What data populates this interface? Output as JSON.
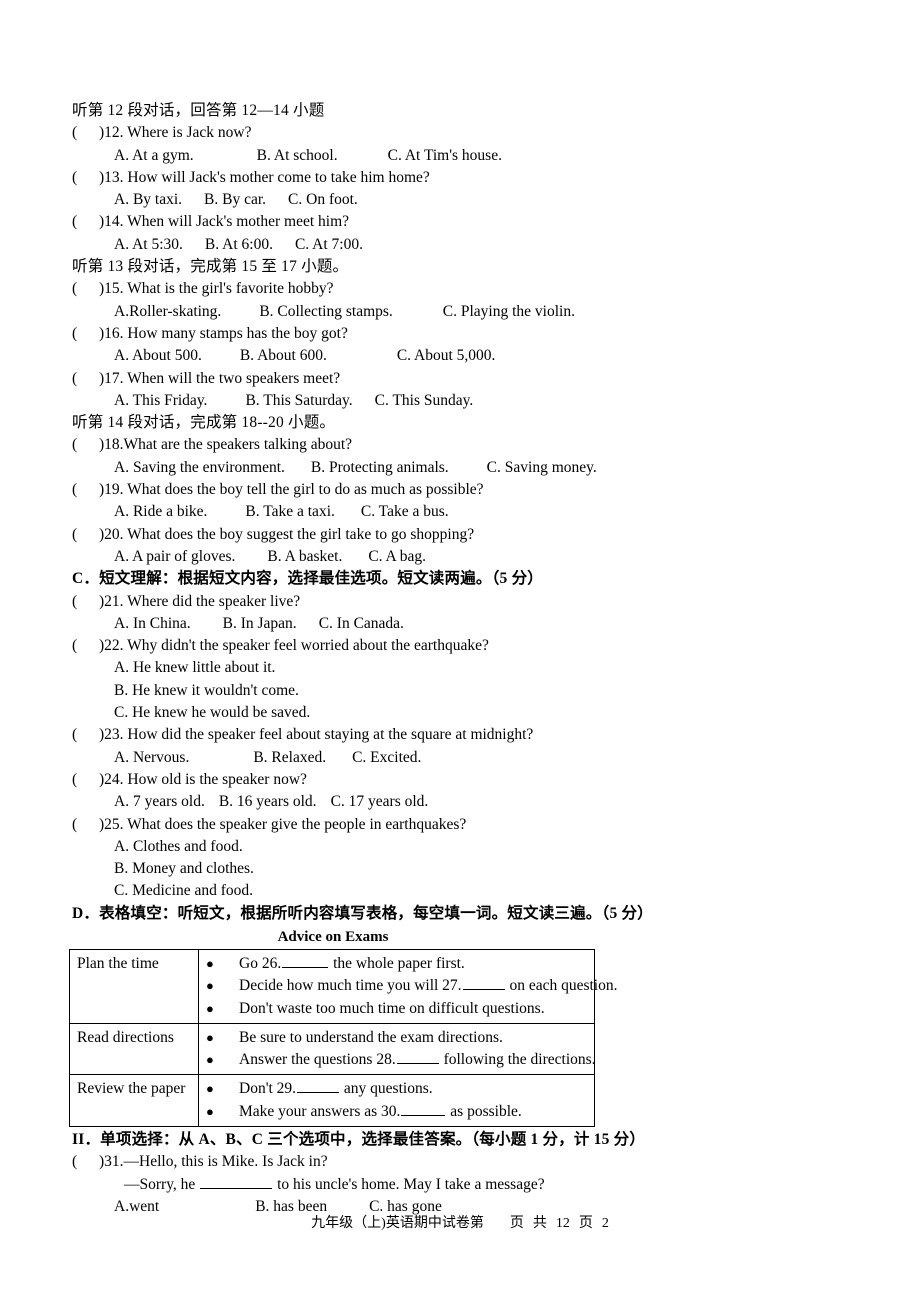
{
  "document": {
    "footer": {
      "prefix": "九年级（上)英语期中试卷第",
      "page_label": "页",
      "total_label": "共",
      "total_pages": "12",
      "pages_unit": "页",
      "page_number": "2"
    }
  },
  "sections": [
    {
      "type": "instruction",
      "name": "dialogue-12-heading",
      "text": "听第 12 段对话，回答第 12—14 小题"
    },
    {
      "type": "question",
      "number": "12",
      "stem": ")12. Where is Jack now?",
      "options": [
        {
          "label": "A. At a gym.",
          "pad": 0
        },
        {
          "label": "B. At school.",
          "pad": 63
        },
        {
          "label": "C. At Tim's house.",
          "pad": 50
        }
      ]
    },
    {
      "type": "question",
      "number": "13",
      "stem": ")13. How will Jack's mother come to take him home?",
      "options": [
        {
          "label": "A. By taxi.",
          "pad": 0
        },
        {
          "label": "B. By car.",
          "pad": 22
        },
        {
          "label": "C. On foot.",
          "pad": 22
        }
      ]
    },
    {
      "type": "question",
      "number": "14",
      "stem": ")14. When will Jack's mother meet him?",
      "options": [
        {
          "label": "A. At 5:30.",
          "pad": 0
        },
        {
          "label": "B. At 6:00.",
          "pad": 22
        },
        {
          "label": "C. At 7:00.",
          "pad": 22
        }
      ]
    },
    {
      "type": "instruction",
      "name": "dialogue-13-heading",
      "text": "听第 13 段对话，完成第 15 至 17 小题。"
    },
    {
      "type": "question",
      "number": "15",
      "stem": ")15. What is the girl's favorite hobby?",
      "options": [
        {
          "label": "A.Roller-skating.",
          "pad": 0
        },
        {
          "label": "B. Collecting stamps.",
          "pad": 38
        },
        {
          "label": "C. Playing the violin.",
          "pad": 50
        }
      ]
    },
    {
      "type": "question",
      "number": "16",
      "stem": ")16. How many stamps has the boy got?",
      "options": [
        {
          "label": "A. About 500.",
          "pad": 0
        },
        {
          "label": "B. About 600.",
          "pad": 38
        },
        {
          "label": "C. About 5,000.",
          "pad": 70
        }
      ]
    },
    {
      "type": "question",
      "number": "17",
      "stem": ")17. When will the two speakers meet?",
      "options": [
        {
          "label": "A. This Friday.",
          "pad": 0
        },
        {
          "label": "B. This Saturday.",
          "pad": 38
        },
        {
          "label": "C. This Sunday.",
          "pad": 22
        }
      ]
    },
    {
      "type": "instruction",
      "name": "dialogue-14-heading",
      "text": "听第 14 段对话，完成第 18--20 小题。"
    },
    {
      "type": "question",
      "number": "18",
      "stem": ")18.What are the speakers talking about?",
      "options": [
        {
          "label": "A. Saving the environment.",
          "pad": 0
        },
        {
          "label": "B. Protecting animals.",
          "pad": 26
        },
        {
          "label": "C. Saving money.",
          "pad": 38
        }
      ]
    },
    {
      "type": "question",
      "number": "19",
      "stem": ")19. What does the boy tell the girl to do as much as possible?",
      "options": [
        {
          "label": "A. Ride a bike.",
          "pad": 0
        },
        {
          "label": "B. Take a taxi.",
          "pad": 38
        },
        {
          "label": "C. Take a bus.",
          "pad": 26
        }
      ]
    },
    {
      "type": "question",
      "number": "20",
      "stem": ")20. What does the boy suggest the girl take to go shopping?",
      "options": [
        {
          "label": "A. A pair of gloves.",
          "pad": 0
        },
        {
          "label": "B. A basket.",
          "pad": 32
        },
        {
          "label": "C. A bag.",
          "pad": 26
        }
      ]
    },
    {
      "type": "part-heading",
      "name": "part-c-heading",
      "text": "C．短文理解：根据短文内容，选择最佳选项。短文读两遍。（5 分）"
    },
    {
      "type": "question",
      "number": "21",
      "stem": ")21. Where did the speaker live?",
      "options": [
        {
          "label": "A. In China.",
          "pad": 0
        },
        {
          "label": "B. In Japan.",
          "pad": 32
        },
        {
          "label": "C. In Canada.",
          "pad": 22
        }
      ]
    },
    {
      "type": "question",
      "number": "22",
      "stem": ")22. Why didn't the speaker feel worried about the earthquake?",
      "stacked_options": [
        "A. He knew little about it.",
        "B. He knew it wouldn't come.",
        "C. He knew he would be saved."
      ]
    },
    {
      "type": "question",
      "number": "23",
      "stem": ")23. How did the speaker feel about staying at the square at midnight?",
      "options": [
        {
          "label": "A. Nervous.",
          "pad": 0
        },
        {
          "label": "B. Relaxed.",
          "pad": 64
        },
        {
          "label": "C. Excited.",
          "pad": 26
        }
      ]
    },
    {
      "type": "question",
      "number": "24",
      "stem": ")24. How old is the speaker now?",
      "options": [
        {
          "label": "A. 7 years old.",
          "pad": 0
        },
        {
          "label": "B. 16 years old.",
          "pad": 14
        },
        {
          "label": "C. 17 years old.",
          "pad": 14
        }
      ]
    },
    {
      "type": "question",
      "number": "25",
      "stem": ")25. What does the speaker give the people in earthquakes?",
      "stacked_options": [
        "A. Clothes and food.",
        "B. Money and clothes.",
        "C. Medicine and food."
      ]
    },
    {
      "type": "part-heading",
      "name": "part-d-heading",
      "text": "D．表格填空：听短文，根据所听内容填写表格，每空填一词。短文读三遍。（5 分）"
    }
  ],
  "table": {
    "title": "Advice on Exams",
    "bullet_glyph": "●",
    "rows": [
      {
        "key": "Plan the time",
        "items": [
          {
            "before": "Go 26.",
            "blank": "w1",
            "after": " the whole paper first."
          },
          {
            "before": "Decide how much time you will 27.",
            "blank": "w2",
            "after": " on each question."
          },
          {
            "before": "Don't waste too much time on difficult questions.",
            "blank": "",
            "after": ""
          }
        ]
      },
      {
        "key": "Read directions",
        "items": [
          {
            "before": "Be sure to understand the exam directions.",
            "blank": "",
            "after": ""
          },
          {
            "before": "Answer the questions 28.",
            "blank": "w2",
            "after": " following the directions."
          }
        ]
      },
      {
        "key": "Review the paper",
        "items": [
          {
            "before": "Don't 29.",
            "blank": "w2",
            "after": " any questions."
          },
          {
            "before": "Make your answers as 30.",
            "blank": "w3",
            "after": " as possible."
          }
        ]
      }
    ]
  },
  "part_two": {
    "heading": "II．单项选择：从 A、B、C 三个选项中，选择最佳答案。（每小题 1 分，计 15 分）",
    "question_31": {
      "stem": ")31.—Hello, this is Mike. Is Jack in?",
      "line2_before": "—Sorry, he ",
      "line2_after": " to his uncle's home. May I take a message?",
      "options": [
        {
          "label": "A.went",
          "pad": 0
        },
        {
          "label": "B. has been",
          "pad": 96
        },
        {
          "label": "C. has gone",
          "pad": 42
        }
      ]
    }
  }
}
